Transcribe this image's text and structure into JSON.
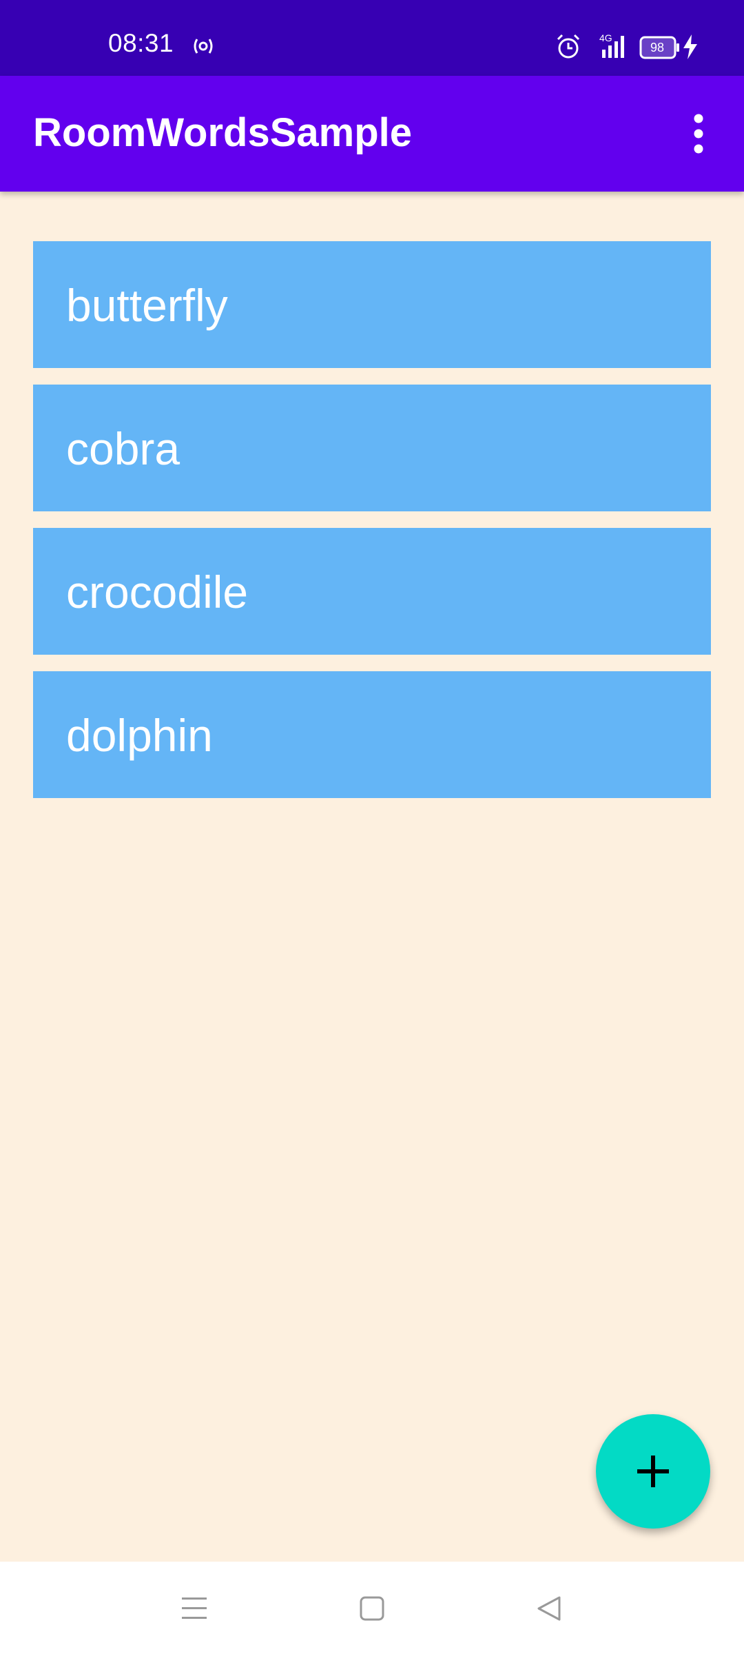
{
  "status_bar": {
    "time": "08:31",
    "network": "4G",
    "battery_level": "98",
    "background_color": "#3700B3"
  },
  "app_bar": {
    "title": "RoomWordsSample",
    "background_color": "#6200EE",
    "overflow_icon": "more-vert-icon"
  },
  "word_list": {
    "items": [
      {
        "word": "butterfly"
      },
      {
        "word": "cobra"
      },
      {
        "word": "crocodile"
      },
      {
        "word": "dolphin"
      }
    ],
    "item_color": "#64B5F6"
  },
  "fab": {
    "icon": "add-icon",
    "color": "#03DAC5"
  },
  "nav_bar": {
    "buttons": [
      "menu-icon",
      "home-icon",
      "back-icon"
    ]
  },
  "background_color": "#FDF0DF"
}
